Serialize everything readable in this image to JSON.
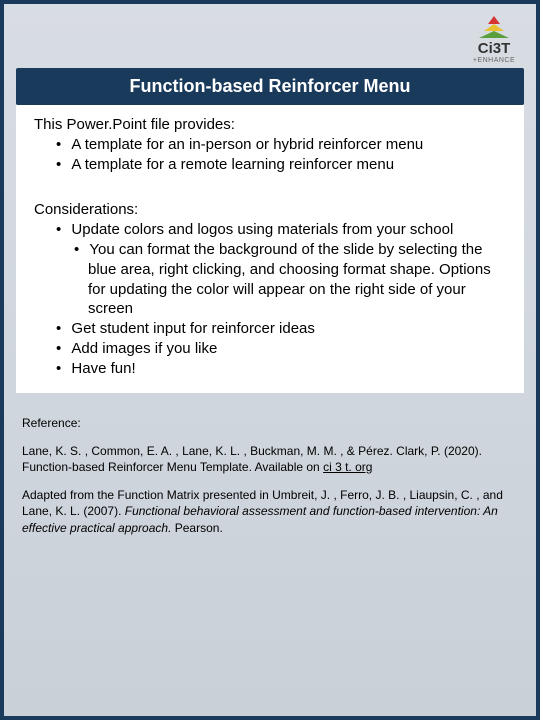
{
  "logo": {
    "text": "Ci3T",
    "subtext": "+ENHANCE"
  },
  "title": "Function-based Reinforcer Menu",
  "intro": "This Power.Point file provides:",
  "intro_bullets": [
    "A template for an in-person or hybrid reinforcer menu",
    "A template for a remote learning reinforcer menu"
  ],
  "considerations_heading": "Considerations:",
  "considerations": {
    "b1": "Update colors and logos using materials from your school",
    "b1_sub": "You can format the background of the slide by selecting the blue area, right clicking, and choosing format shape. Options for updating the color will appear on the right side of your screen",
    "b2": "Get student input for reinforcer ideas",
    "b3": "Add images if you like",
    "b4": "Have fun!"
  },
  "reference": {
    "heading": "Reference:",
    "p1_pre": "Lane, K. S. , Common, E. A. , Lane, K. L. , Buckman, M. M. , & Pérez. Clark, P. (2020). Function-based Reinforcer Menu Template. Available on ",
    "p1_link": "ci 3 t. org",
    "p2_pre": "Adapted from the Function Matrix presented in Umbreit, J. , Ferro, J. B. , Liaupsin, C. , and Lane, K. L. (2007). ",
    "p2_italic": "Functional behavioral assessment and function-based intervention: An effective practical approach. ",
    "p2_post": "Pearson."
  }
}
